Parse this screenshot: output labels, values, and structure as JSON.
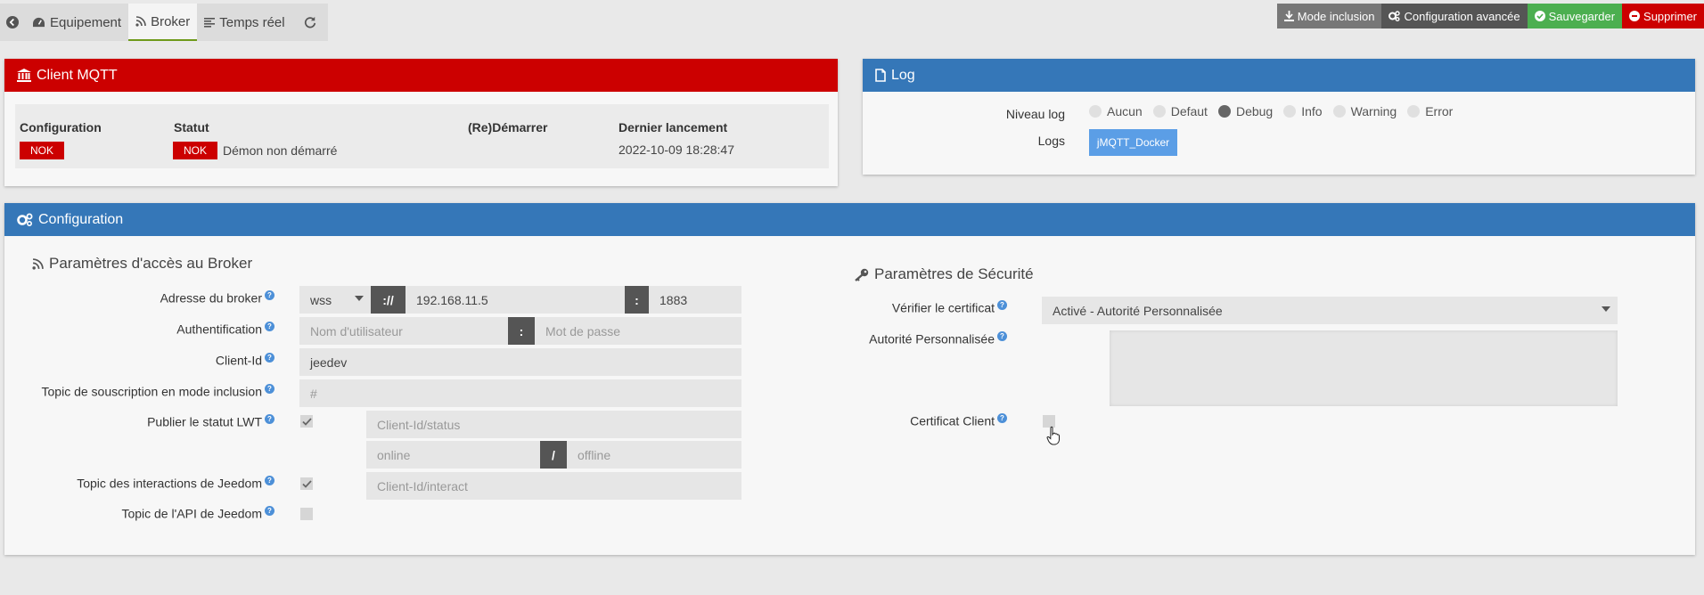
{
  "tabs": {
    "equipement": "Equipement",
    "broker": "Broker",
    "temps_reel": "Temps réel"
  },
  "actions": {
    "mode_inclusion": "Mode inclusion",
    "config_avancee": "Configuration avancée",
    "sauvegarder": "Sauvegarder",
    "supprimer": "Supprimer"
  },
  "client": {
    "title": "Client MQTT",
    "headers": [
      "Configuration",
      "Statut",
      "(Re)Démarrer",
      "Dernier lancement"
    ],
    "config_badge": "NOK",
    "status_badge": "NOK",
    "status_text": "Démon non démarré",
    "last_launch": "2022-10-09 18:28:47"
  },
  "log": {
    "title": "Log",
    "level_label": "Niveau log",
    "logs_label": "Logs",
    "levels": [
      "Aucun",
      "Defaut",
      "Debug",
      "Info",
      "Warning",
      "Error"
    ],
    "selected": "Debug",
    "log_button": "jMQTT_Docker"
  },
  "config": {
    "title": "Configuration",
    "broker_section": "Paramètres d'accès au Broker",
    "security_section": "Paramètres de Sécurité",
    "labels": {
      "address": "Adresse du broker",
      "auth": "Authentification",
      "client_id": "Client-Id",
      "topic_inclusion": "Topic de souscription en mode inclusion",
      "lwt": "Publier le statut LWT",
      "interact": "Topic des interactions de Jeedom",
      "api": "Topic de l'API de Jeedom",
      "verify_cert": "Vérifier le certificat",
      "custom_ca": "Autorité Personnalisée",
      "client_cert": "Certificat Client"
    },
    "protocol": "wss",
    "sep_proto": "://",
    "host": "192.168.11.5",
    "sep_port": ":",
    "port": "1883",
    "user_placeholder": "Nom d'utilisateur",
    "sep_auth": ":",
    "pass_placeholder": "Mot de passe",
    "client_id": "jeedev",
    "topic_placeholder": "#",
    "lwt_topic_placeholder": "Client-Id/status",
    "lwt_online_placeholder": "online",
    "sep_lwt": "/",
    "lwt_offline_placeholder": "offline",
    "interact_placeholder": "Client-Id/interact",
    "verify_value": "Activé - Autorité Personnalisée",
    "help": "?"
  }
}
